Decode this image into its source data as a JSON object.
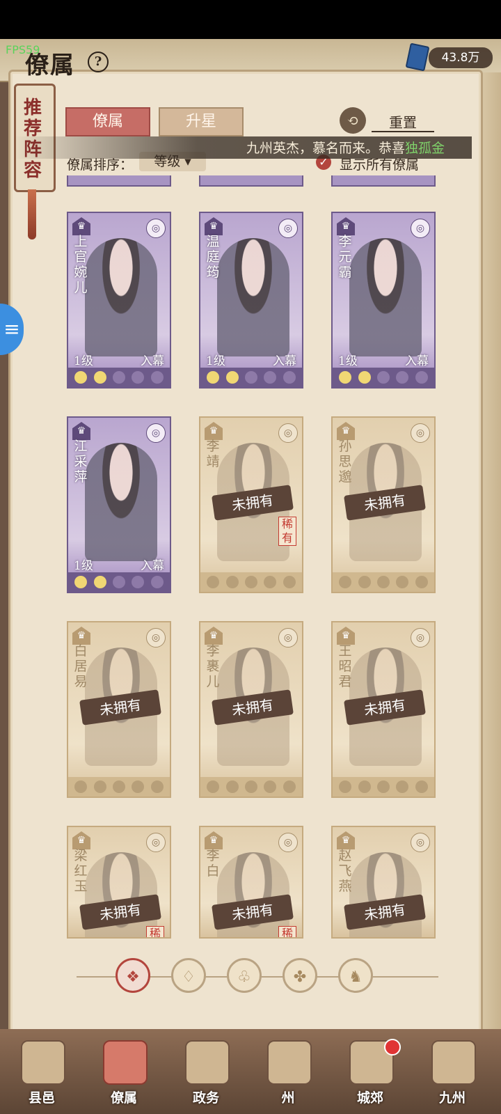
{
  "status": {
    "fps": "FPS59"
  },
  "header": {
    "title": "僚属",
    "currency_amount": "43.8万"
  },
  "side_tab": {
    "label": "推荐阵容"
  },
  "tabs": [
    {
      "label": "僚属"
    },
    {
      "label": "升星"
    }
  ],
  "reset": {
    "label": "重置"
  },
  "notice": {
    "text": "九州英杰，慕名而来。恭喜",
    "name": "独孤金"
  },
  "sort": {
    "label": "僚属排序：",
    "value": "等级 ▾"
  },
  "show_all": {
    "label": "显示所有僚属",
    "checked": true
  },
  "cards": [
    {
      "name": "上官婉儿",
      "level": "1级",
      "status": "入幕",
      "owned": true,
      "stars_on": 2,
      "stars_total": 5
    },
    {
      "name": "温庭筠",
      "level": "1级",
      "status": "入幕",
      "owned": true,
      "stars_on": 2,
      "stars_total": 5
    },
    {
      "name": "李元霸",
      "level": "1级",
      "status": "入幕",
      "owned": true,
      "stars_on": 2,
      "stars_total": 5
    },
    {
      "name": "江采萍",
      "level": "1级",
      "status": "入幕",
      "owned": true,
      "stars_on": 2,
      "stars_total": 5
    },
    {
      "name": "李靖",
      "stamp": "未拥有",
      "rarity": "稀有",
      "owned": false,
      "stars_on": 0,
      "stars_total": 5
    },
    {
      "name": "孙思邈",
      "stamp": "未拥有",
      "owned": false,
      "stars_on": 0,
      "stars_total": 5
    },
    {
      "name": "白居易",
      "stamp": "未拥有",
      "owned": false,
      "stars_on": 0,
      "stars_total": 5
    },
    {
      "name": "李裹儿",
      "stamp": "未拥有",
      "owned": false,
      "stars_on": 0,
      "stars_total": 5
    },
    {
      "name": "王昭君",
      "stamp": "未拥有",
      "owned": false,
      "stars_on": 0,
      "stars_total": 5
    },
    {
      "name": "梁红玉",
      "stamp": "未拥有",
      "rarity": "稀",
      "owned": false,
      "stars_on": 0,
      "stars_total": 5
    },
    {
      "name": "李白",
      "stamp": "未拥有",
      "rarity": "稀",
      "owned": false,
      "stars_on": 0,
      "stars_total": 5
    },
    {
      "name": "赵飞燕",
      "stamp": "未拥有",
      "owned": false,
      "stars_on": 0,
      "stars_total": 5
    }
  ],
  "filters": [
    {
      "icon": "all-filter-icon",
      "glyph": "❖",
      "active": true
    },
    {
      "icon": "bell-filter-icon",
      "glyph": "♢",
      "active": false
    },
    {
      "icon": "gourd-filter-icon",
      "glyph": "♧",
      "active": false
    },
    {
      "icon": "fan-filter-icon",
      "glyph": "✤",
      "active": false
    },
    {
      "icon": "horse-filter-icon",
      "glyph": "♞",
      "active": false
    }
  ],
  "bottom_nav": [
    {
      "label": "县邑",
      "active": false
    },
    {
      "label": "僚属",
      "active": true
    },
    {
      "label": "政务",
      "active": false
    },
    {
      "label": "州",
      "active": false
    },
    {
      "label": "城郊",
      "active": false,
      "badge": true
    },
    {
      "label": "九州",
      "active": false
    }
  ],
  "colors": {
    "accent_red": "#c66d66",
    "owned_purple": "#6d5a8a",
    "unowned_tan": "#d0b88f",
    "paper": "#eee3cf"
  }
}
